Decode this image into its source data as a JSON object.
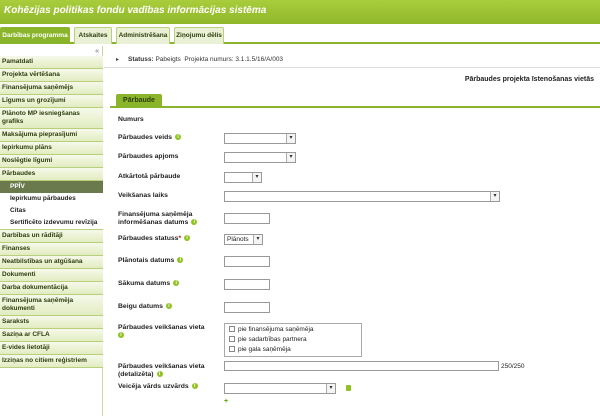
{
  "app": {
    "title": "Kohēzijas politikas fondu vadības informācijas sistēma"
  },
  "tabs": [
    {
      "label": "Darbības programma",
      "active": true
    },
    {
      "label": "Atskaites"
    },
    {
      "label": "Administrēšana"
    },
    {
      "label": "Ziņojumu dēlis"
    }
  ],
  "sidebar": {
    "collapse_icon": "«",
    "items": [
      {
        "label": "Pamatdati"
      },
      {
        "label": "Projekta vērtēšana"
      },
      {
        "label": "Finansējuma saņēmējs"
      },
      {
        "label": "Līgums un grozījumi"
      },
      {
        "label": "Plānoto MP iesniegšanas grafiks"
      },
      {
        "label": "Maksājuma pieprasījumi"
      },
      {
        "label": "Iepirkumu plāns"
      },
      {
        "label": "Noslēgtie līgumi"
      },
      {
        "label": "Pārbaudes"
      },
      {
        "label": "PPĪV",
        "active": true
      },
      {
        "label": "Darbības un rādītāji"
      },
      {
        "label": "Finanses"
      },
      {
        "label": "Neatbilstības un atgūšana"
      },
      {
        "label": "Dokumenti"
      },
      {
        "label": "Darba dokumentācija"
      },
      {
        "label": "Finansējuma saņēmēja dokumenti"
      },
      {
        "label": "Saraksts"
      },
      {
        "label": "Saziņa ar CFLA"
      },
      {
        "label": "E-vides lietotāji"
      },
      {
        "label": "Izziņas no citiem reģistriem"
      }
    ],
    "subitems": [
      {
        "label": "Iepirkumu pārbaudes"
      },
      {
        "label": "Citas"
      },
      {
        "label": "Sertificēto izdevumu revīzija"
      }
    ]
  },
  "status": {
    "status_label": "Statuss:",
    "status_value": "Pabeigts",
    "project_label": "Projekta numurs:",
    "project_value": "3.1.1.5/16/A/003"
  },
  "section_title": "Pārbaudes projekta īstenošanas vietās",
  "inner_tab": "Pārbaude",
  "form": {
    "numurs": "Numurs",
    "parbaudes_veids": "Pārbaudes veids",
    "parbaudes_apjoms": "Pārbaudes apjoms",
    "atkartota": "Atkārtotā pārbaude",
    "veiksanas_laiks": "Veikšanas laiks",
    "fin_sanemeja_label_1": "Finansējuma saņēmēja",
    "fin_sanemeja_label_2": "informēšanas datums",
    "statuss": "Pārbaudes statuss",
    "statuss_req": "*",
    "statuss_value": "Plānots",
    "planotais": "Plānotais datums",
    "sakuma": "Sākuma datums",
    "beigu": "Beigu datums",
    "vieta": "Pārbaudes veikšanas vieta",
    "vieta_options": [
      "pie finansējuma saņēmēja",
      "pie sadarbības partnera",
      "pie gala saņēmēja"
    ],
    "vieta_det_1": "Pārbaudes veikšanas vieta",
    "vieta_det_2": "(detalizēta)",
    "vieta_counter": "250/250",
    "veiceja": "Veicēja vārds uzvārds"
  }
}
